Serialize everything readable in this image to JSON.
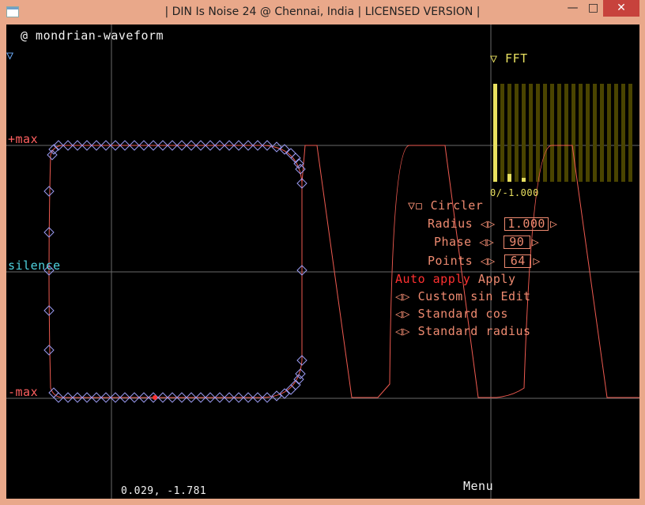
{
  "window": {
    "title": "| DIN Is Noise 24 @ Chennai, India | LICENSED VERSION |",
    "minimize": "—",
    "maximize": "□",
    "close": "✕"
  },
  "editor": {
    "waveform_name": "@ mondrian-waveform",
    "collapse_arrow": "▽",
    "max_label": "+max",
    "min_label": "-max",
    "silence_label": "silence",
    "cursor_readout": "0.029, -1.781",
    "menu_label": "Menu"
  },
  "fft": {
    "header": "▽ FFT",
    "range_label": "0/-1.000",
    "bars": [
      1.0,
      0.0,
      0.08,
      0.0,
      0.04,
      0.0,
      0.0,
      0.0,
      0.0,
      0.0,
      0.0,
      0.0,
      0.0,
      0.0,
      0.0,
      0.0,
      0.0,
      0.0,
      0.0,
      0.0
    ]
  },
  "circler": {
    "header": "▽◻ Circler",
    "radius_label": "Radius",
    "radius_value": "1.000",
    "phase_label": "Phase",
    "phase_value": "90",
    "points_label": "Points",
    "points_value": "64",
    "auto_apply": "Auto apply",
    "apply": "Apply",
    "custom_sin": "Custom sin",
    "edit": "Edit",
    "standard_cos": "Standard cos",
    "standard_radius": "Standard radius",
    "arrows": "◁▷"
  },
  "colors": {
    "accent_orange": "#ee8a70",
    "auto_apply_red": "#ff3030",
    "silence_cyan": "#4fd3e0",
    "fft_yellow": "#e8e060",
    "grid": "#6a6a6a"
  }
}
